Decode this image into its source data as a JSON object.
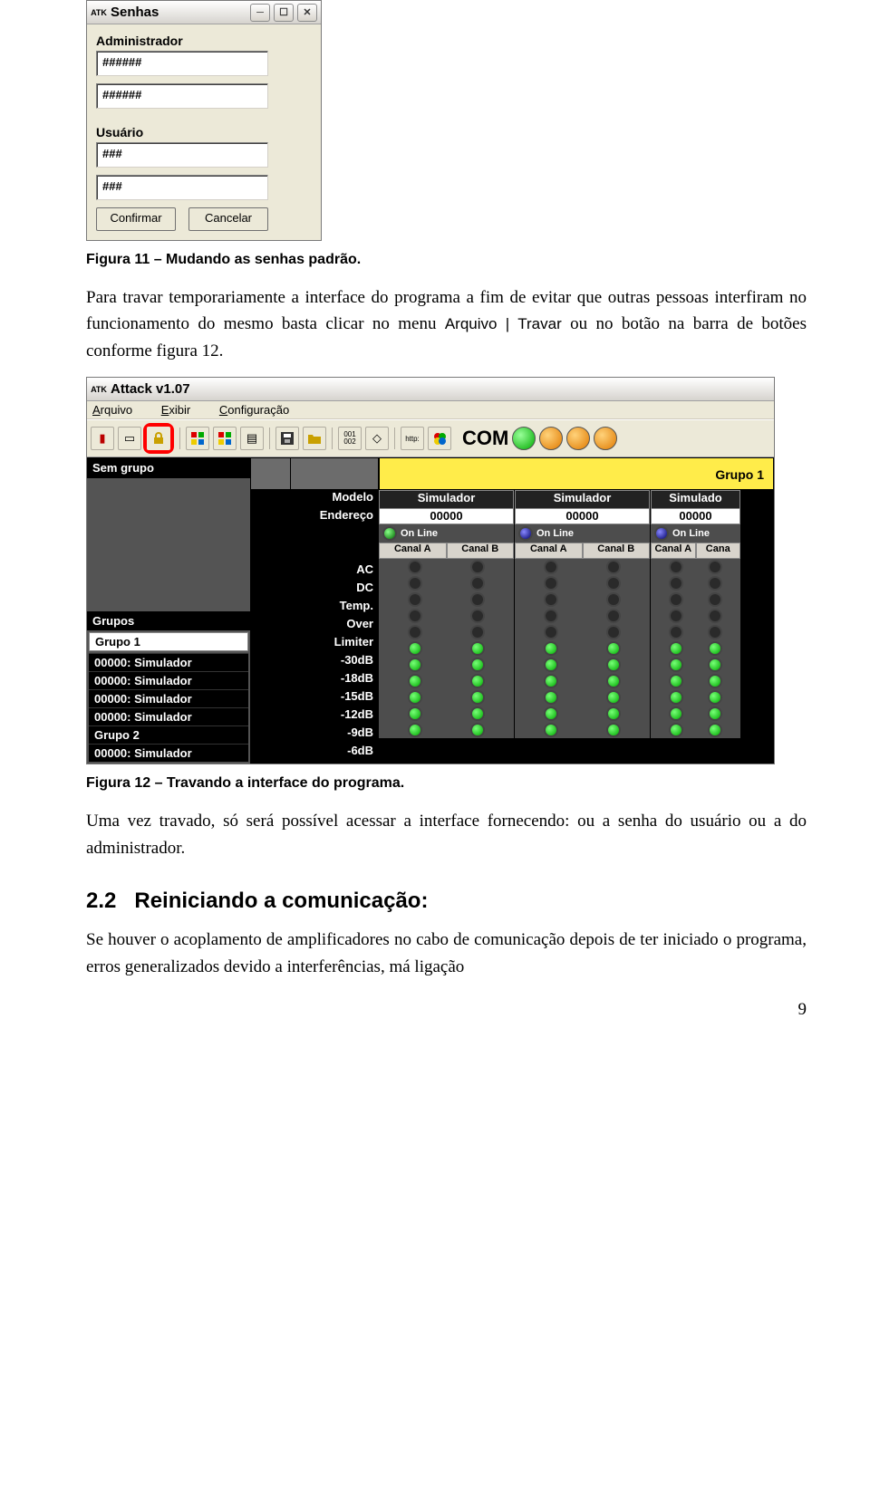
{
  "page_number": "9",
  "dialog": {
    "title": "Senhas",
    "app_icon_text": "ATK",
    "admin_label": "Administrador",
    "user_label": "Usuário",
    "admin_field1": "######",
    "admin_field2": "######",
    "user_field1": "###",
    "user_field2": "###",
    "confirm": "Confirmar",
    "cancel": "Cancelar"
  },
  "caption11": "Figura 11 – Mudando as senhas padrão.",
  "para1_a": "Para travar temporariamente a interface do programa a fim de evitar que outras pessoas interfiram no funcionamento do mesmo basta clicar no menu ",
  "para1_menu": "Arquivo | Travar",
  "para1_b": " ou no botão na barra de botões conforme figura 12.",
  "appwin": {
    "title": "Attack v1.07",
    "app_icon_text": "ATK",
    "menu": {
      "file": "Arquivo",
      "view": "Exibir",
      "config": "Configuração"
    },
    "com_label": "COM",
    "left": {
      "nogroup": "Sem grupo",
      "groups_label": "Grupos",
      "items": [
        "Grupo 1",
        "00000: Simulador",
        "00000: Simulador",
        "00000: Simulador",
        "00000: Simulador",
        "Grupo 2",
        "00000: Simulador"
      ]
    },
    "group_header": "Grupo 1",
    "center_labels": {
      "modelo": "Modelo",
      "endereco": "Endereço",
      "online": "On Line",
      "rows": [
        "AC",
        "DC",
        "Temp.",
        "Over",
        "Limiter",
        "-30dB",
        "-18dB",
        "-15dB",
        "-12dB",
        "-9dB",
        "-6dB"
      ]
    },
    "sim": {
      "header": "Simulador",
      "addr": "00000",
      "online": "On Line",
      "canalA": "Canal A",
      "canalB": "Canal B",
      "canalShort": "Cana"
    }
  },
  "caption12": "Figura 12 – Travando a interface do programa.",
  "para2": "Uma vez travado, só será possível acessar a interface fornecendo: ou a senha do usuário ou a do administrador.",
  "section": {
    "num": "2.2",
    "title": "Reiniciando a comunicação:"
  },
  "para3": "Se houver o acoplamento de amplificadores no cabo de comunicação depois de ter iniciado o programa, erros generalizados devido a interferências, má ligação"
}
